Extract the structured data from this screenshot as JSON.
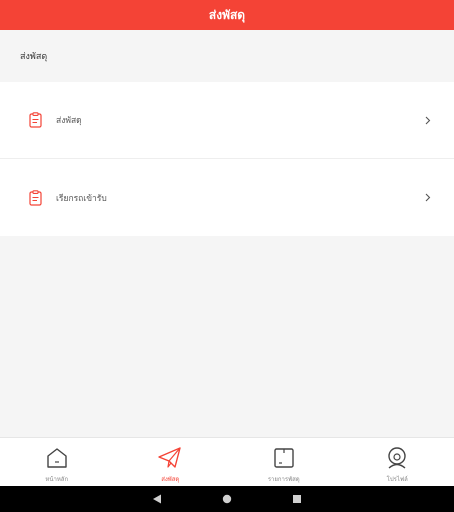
{
  "header": {
    "title": "ส่งพัสดุ"
  },
  "section": {
    "title": "ส่งพัสดุ"
  },
  "menu": {
    "items": [
      {
        "label": "ส่งพัสดุ",
        "icon": "clipboard-icon"
      },
      {
        "label": "เรียกรถเข้ารับ",
        "icon": "clipboard-icon"
      }
    ]
  },
  "bottom_nav": {
    "active_index": 1,
    "items": [
      {
        "label": "หน้าหลัก",
        "icon": "home-icon"
      },
      {
        "label": "ส่งพัสดุ",
        "icon": "paper-plane-icon"
      },
      {
        "label": "รายการพัสดุ",
        "icon": "package-icon"
      },
      {
        "label": "โปรไฟล์",
        "icon": "profile-icon"
      }
    ]
  },
  "colors": {
    "accent": "#f44336",
    "inactive": "#888888",
    "icon_dark": "#444444"
  },
  "system_nav": {
    "buttons": [
      "back-icon",
      "home-circle-icon",
      "recents-icon"
    ]
  }
}
